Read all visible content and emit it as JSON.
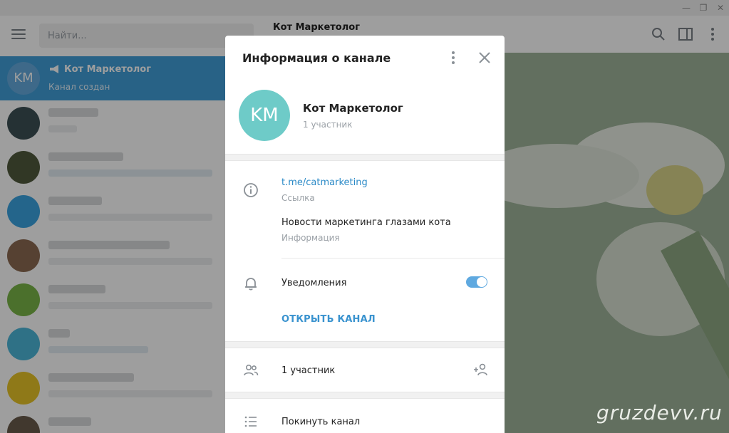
{
  "window": {
    "minimize_glyph": "—",
    "maximize_glyph": "❐",
    "close_glyph": "✕"
  },
  "sidebar": {
    "search_placeholder": "Найти...",
    "active_chat": {
      "avatar_initials": "KM",
      "name": "Кот Маркетолог",
      "preview": "Канал создан"
    }
  },
  "chat_header": {
    "title": "Кот Маркетолог"
  },
  "modal": {
    "title": "Информация о канале",
    "channel_initials": "KM",
    "channel_name": "Кот Маркетолог",
    "members_subtitle": "1 участник",
    "link_value": "t.me/catmarketing",
    "link_label": "Ссылка",
    "info_value": "Новости маркетинга глазами кота",
    "info_label": "Информация",
    "notifications_label": "Уведомления",
    "notifications_enabled": true,
    "open_channel_label": "ОТКРЫТЬ КАНАЛ",
    "members_row_label": "1 участник",
    "leave_label": "Покинуть канал"
  },
  "watermark": "gruzdevv.ru",
  "colors": {
    "accent": "#419fd9",
    "link": "#2b8ac7",
    "avatar": "#6ecbc8",
    "toggle": "#5fa9e0"
  }
}
